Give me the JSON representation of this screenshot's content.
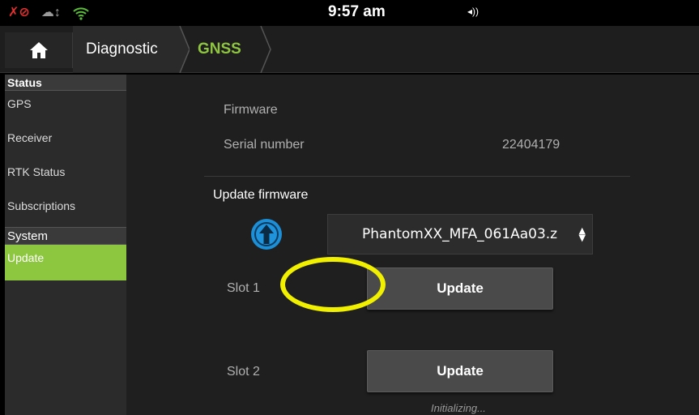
{
  "status_bar": {
    "time": "9:57 am",
    "icons": [
      "gps-off-icon",
      "cloud-sync-icon",
      "wifi-icon",
      "volume-icon"
    ],
    "gps_glyph": "✗⊘",
    "cloud_glyph": "☁↕",
    "volume_glyph": "◂))"
  },
  "nav": {
    "home_icon": "home-icon",
    "breadcrumbs": [
      "Diagnostic",
      "GNSS"
    ],
    "accent_color": "#8ec63f"
  },
  "sidebar": {
    "sections": [
      {
        "title": "Status",
        "items": [
          "GPS",
          "Receiver",
          "RTK Status",
          "Subscriptions"
        ]
      },
      {
        "title": "System",
        "items": [
          "Update"
        ]
      }
    ],
    "active_item": "Update"
  },
  "main": {
    "firmware_label": "Firmware",
    "firmware_value": "",
    "serial_label": "Serial number",
    "serial_value": "22404179",
    "update_heading": "Update firmware",
    "upload_icon": "upload-arrow-icon",
    "firmware_select_value": "PhantomXX_MFA_061Aa03.z",
    "slots": [
      {
        "label": "Slot 1",
        "button": "Update",
        "status": ""
      },
      {
        "label": "Slot 2",
        "button": "Update",
        "status": "Initializing..."
      }
    ],
    "highlight_color": "#f0f000"
  }
}
